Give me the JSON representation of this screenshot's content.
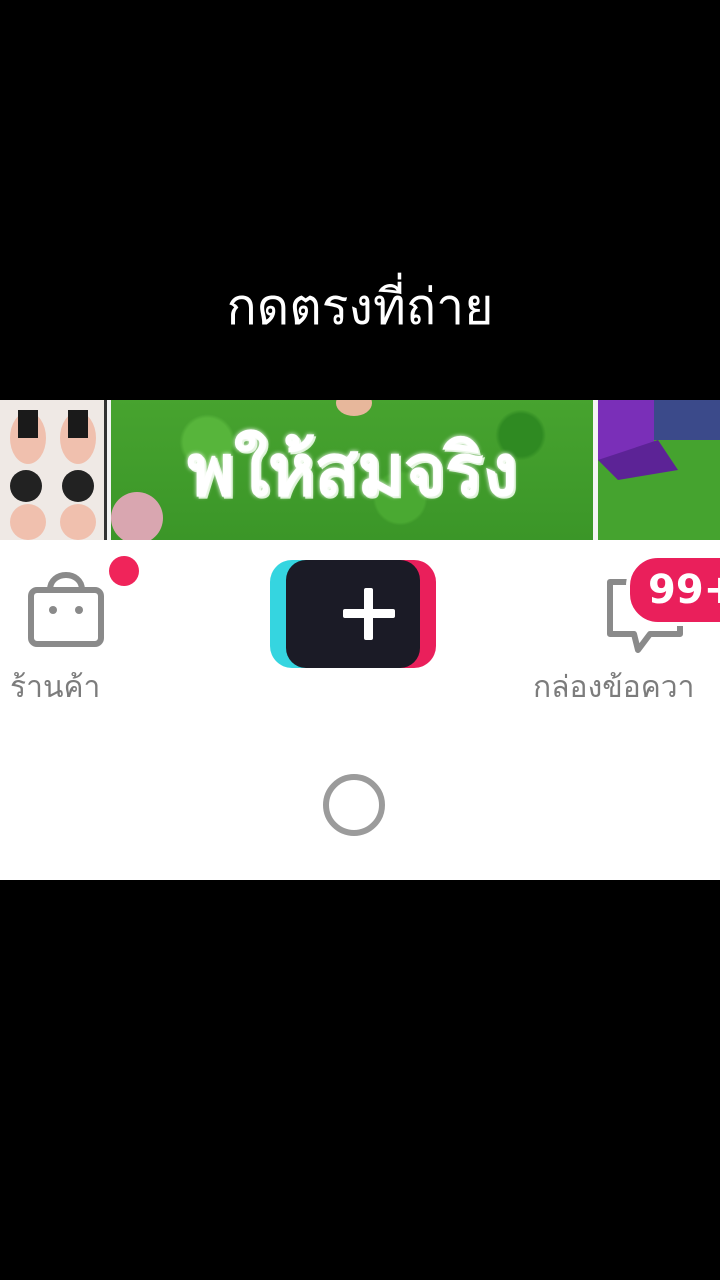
{
  "caption": "กดตรงที่ถ่าย",
  "thumbnail_strip": {
    "center_text": "พให้สมจริง"
  },
  "bottom_nav": {
    "shop_label": "ร้านค้า",
    "inbox_label": "กล่องข้อควา",
    "inbox_badge": "99+",
    "shop_icon": "shopping-bag-icon",
    "inbox_icon": "message-icon",
    "create_icon": "plus-icon"
  },
  "colors": {
    "accent_red": "#ea1f5b",
    "accent_cyan": "#35d5e0",
    "create_button": "#1b1b26"
  }
}
